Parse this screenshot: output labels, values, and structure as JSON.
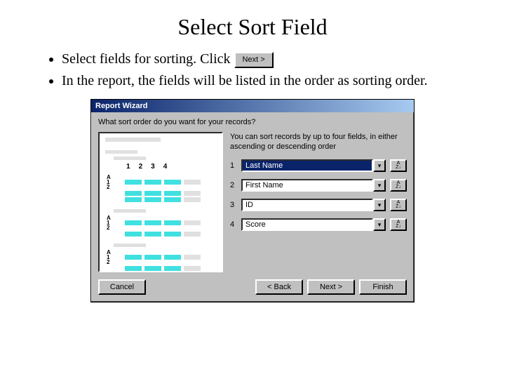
{
  "slide": {
    "title": "Select Sort Field",
    "bullet1_prefix": "Select fields for sorting. Click",
    "bullet2": "In the report, the fields will be listed in the order as sorting order.",
    "inline_next_label": "Next >"
  },
  "dialog": {
    "title": "Report Wizard",
    "prompt": "What sort order do you want for your records?",
    "hint": "You can sort records by up to four fields, in either ascending or descending order",
    "preview_cols": [
      "1",
      "2",
      "3",
      "4"
    ],
    "preview_group_rows": [
      "A",
      "1",
      "2"
    ],
    "sort_rows": [
      {
        "num": "1",
        "value": "Last Name",
        "focused": true
      },
      {
        "num": "2",
        "value": "First Name",
        "focused": false
      },
      {
        "num": "3",
        "value": "ID",
        "focused": false
      },
      {
        "num": "4",
        "value": "Score",
        "focused": false
      }
    ],
    "az_top": "A",
    "az_bottom": "Z↓",
    "buttons": {
      "cancel": "Cancel",
      "back": "< Back",
      "next": "Next >",
      "finish": "Finish"
    }
  }
}
